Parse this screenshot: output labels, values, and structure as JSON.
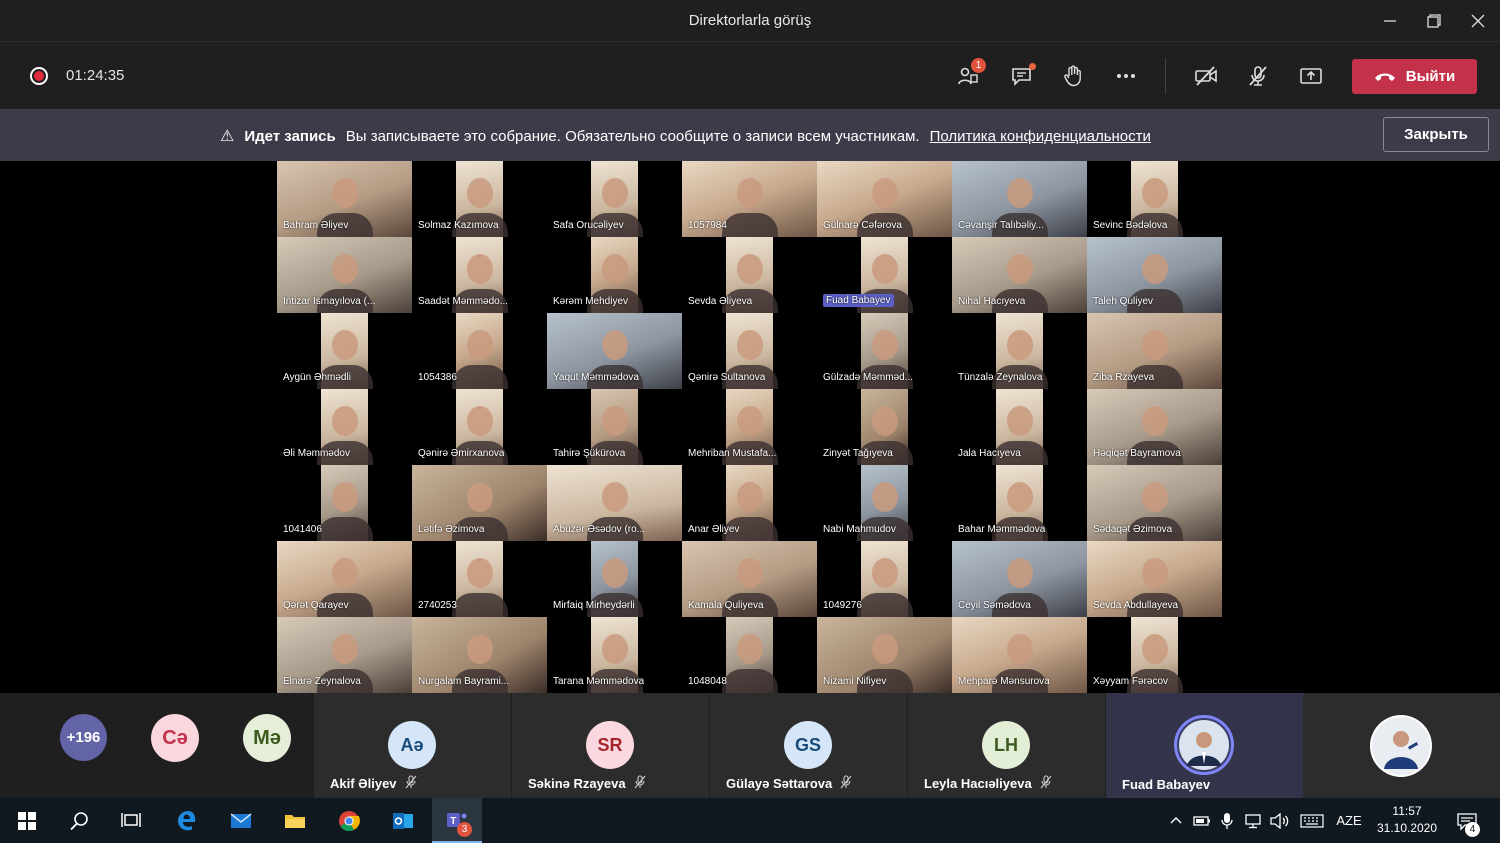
{
  "window": {
    "title": "Direktorlarla görüş",
    "minimize_icon": "minimize-icon",
    "restore_icon": "restore-icon",
    "close_icon": "close-icon"
  },
  "meeting_controls": {
    "timer": "01:24:35",
    "participants_badge": "1",
    "leave_label": "Выйти"
  },
  "banner": {
    "title": "Идет запись",
    "message": "Вы записываете это собрание. Обязательно сообщите о записи всем участникам.",
    "link": "Политика конфиденциальности",
    "close_label": "Закрыть"
  },
  "grid": [
    {
      "name": "Bahram Əliyev",
      "w": "wide",
      "v": "v0"
    },
    {
      "name": "Solmaz Kazımova",
      "w": "narrow",
      "v": "v1"
    },
    {
      "name": "Safa Orucəliyev",
      "w": "narrow",
      "v": "v1"
    },
    {
      "name": "1057984",
      "w": "wide",
      "v": "v3"
    },
    {
      "name": "Gülnarə Cəfərova",
      "w": "wide",
      "v": "v3"
    },
    {
      "name": "Cəvanşir Talıbəliy...",
      "w": "wide",
      "v": "v4"
    },
    {
      "name": "Sevinc Bədəlova",
      "w": "narrow",
      "v": "v1"
    },
    {
      "name": "İntizar İsmayılova (...",
      "w": "wide",
      "v": "v5"
    },
    {
      "name": "Saadət Məmmədo...",
      "w": "narrow",
      "v": "v1"
    },
    {
      "name": "Kərəm Mehdiyev",
      "w": "narrow",
      "v": "v3"
    },
    {
      "name": "Sevda Əliyeva",
      "w": "narrow",
      "v": "v1"
    },
    {
      "name": "Fuad Babayev",
      "w": "narrow",
      "v": "v1",
      "hl": true
    },
    {
      "name": "Nihal Hacıyeva",
      "w": "wide",
      "v": "v5"
    },
    {
      "name": "Taleh Quliyev",
      "w": "wide",
      "v": "v4"
    },
    {
      "name": "Aygün Əhmədli",
      "w": "narrow",
      "v": "v1"
    },
    {
      "name": "1054386",
      "w": "narrow",
      "v": "v3"
    },
    {
      "name": "Yaqut Məmmədova",
      "w": "wide",
      "v": "v4"
    },
    {
      "name": "Qənirə Sultanova",
      "w": "narrow",
      "v": "v1"
    },
    {
      "name": "Gülzadə Məmməd...",
      "w": "narrow",
      "v": "v5"
    },
    {
      "name": "Tünzalə Zeynalova",
      "w": "narrow",
      "v": "v1"
    },
    {
      "name": "Ziba Rzayeva",
      "w": "wide",
      "v": "v0"
    },
    {
      "name": "Əli Məmmədov",
      "w": "narrow",
      "v": "v1"
    },
    {
      "name": "Qənirə Əmirxanova",
      "w": "narrow",
      "v": "v1"
    },
    {
      "name": "Tahirə Şükürova",
      "w": "narrow",
      "v": "v0"
    },
    {
      "name": "Mehriban Mustafa...",
      "w": "narrow",
      "v": "v3"
    },
    {
      "name": "Zinyət Tağıyeva",
      "w": "narrow",
      "v": "v2"
    },
    {
      "name": "Jala Hacıyeva",
      "w": "narrow",
      "v": "v1"
    },
    {
      "name": "Həqiqət Bayramova",
      "w": "wide",
      "v": "v5"
    },
    {
      "name": "1041406",
      "w": "narrow",
      "v": "v5"
    },
    {
      "name": "Lətifə Əzimova",
      "w": "wide",
      "v": "v2"
    },
    {
      "name": "Abuzər Əsədov (ro...",
      "w": "wide",
      "v": "v1"
    },
    {
      "name": "Anar Əliyev",
      "w": "narrow",
      "v": "v3"
    },
    {
      "name": "Nabi Mahmudov",
      "w": "narrow",
      "v": "v4"
    },
    {
      "name": "Bahar Məmmədova",
      "w": "narrow",
      "v": "v1"
    },
    {
      "name": "Sədaqət Əzimova",
      "w": "wide",
      "v": "v5"
    },
    {
      "name": "Qərət Qarayev",
      "w": "wide",
      "v": "v3"
    },
    {
      "name": "2740253",
      "w": "narrow",
      "v": "v1"
    },
    {
      "name": "Mirfaiq Mirheydərli",
      "w": "narrow",
      "v": "v4"
    },
    {
      "name": "Kamala Quliyeva",
      "w": "wide",
      "v": "v0"
    },
    {
      "name": "1049276",
      "w": "narrow",
      "v": "v1"
    },
    {
      "name": "Ceyil Səmədova",
      "w": "wide",
      "v": "v4"
    },
    {
      "name": "Sevda Abdullayeva",
      "w": "wide",
      "v": "v3"
    },
    {
      "name": "Elnarə Zeynalova",
      "w": "wide",
      "v": "v5"
    },
    {
      "name": "Nurgalam Bayrami...",
      "w": "wide",
      "v": "v2"
    },
    {
      "name": "Tarana Məmmədova",
      "w": "narrow",
      "v": "v1"
    },
    {
      "name": "1048048",
      "w": "narrow",
      "v": "v5"
    },
    {
      "name": "Nizami Nifiyev",
      "w": "wide",
      "v": "v2"
    },
    {
      "name": "Mehparə Mənsurova",
      "w": "wide",
      "v": "v3"
    },
    {
      "name": "Xəyyam Fərəcov",
      "w": "narrow",
      "v": "v1"
    }
  ],
  "strip": {
    "overflow": {
      "label": "+196",
      "bg": "#6264a7",
      "fg": "#ffffff"
    },
    "small_avatars": [
      {
        "initials": "Cə",
        "bg": "#f9d7dd",
        "fg": "#c4314b"
      },
      {
        "initials": "Mə",
        "bg": "#e5eed8",
        "fg": "#3d5a1f"
      }
    ],
    "tiles": [
      {
        "initials": "Aə",
        "name": "Akif Əliyev",
        "bg": "#d4e6f8",
        "fg": "#1a4b78"
      },
      {
        "initials": "SR",
        "name": "Səkinə Rzayeva",
        "bg": "#fbd7df",
        "fg": "#a4262c"
      },
      {
        "initials": "GS",
        "name": "Gülayə Səttarova",
        "bg": "#d4e6f8",
        "fg": "#1a4b78"
      },
      {
        "initials": "LH",
        "name": "Leyla Hacıəliyeva",
        "bg": "#e3eed7",
        "fg": "#3d5a1f"
      },
      {
        "initials": "",
        "name": "Fuad Babayev",
        "bg": "#3a3d66",
        "fg": "#ffffff"
      }
    ]
  },
  "taskbar": {
    "language": "AZE",
    "time": "11:57",
    "date": "31.10.2020",
    "teams_badge": "3",
    "notifications_badge": "4"
  }
}
